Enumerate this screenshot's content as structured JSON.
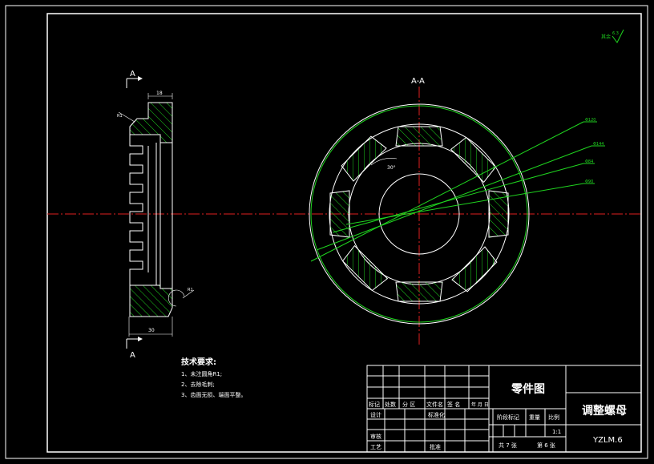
{
  "section_view": {
    "marker_top": "A",
    "marker_bottom": "A",
    "dim_top": "18",
    "dim_bottom": "30",
    "chamfer_top": "R1",
    "chamfer_bottom": "R1"
  },
  "front_view": {
    "title": "A-A",
    "angle_label": "30°",
    "leaders": [
      "Φ120",
      "Φ144",
      "Φ84",
      "Φ90"
    ]
  },
  "roughness": {
    "label": "其余",
    "value": "6.3"
  },
  "tech_req": {
    "title": "技术要求:",
    "items": [
      "1、未注圆角R1;",
      "2、去除毛刺;",
      "3、齿面无损、端面平整。"
    ]
  },
  "title_block": {
    "drawing_type": "零件图",
    "part_name": "调整螺母",
    "drawing_no": "YZLM.6",
    "scale": "1:1",
    "sheet_total": "共 7 张",
    "sheet_no": "第 6 张",
    "header_labels": [
      "标记",
      "处数",
      "分 区",
      "文件名",
      "签 名",
      "年 月 日"
    ],
    "row_labels": [
      "设计",
      "审核",
      "工艺"
    ],
    "standardization": "标准化",
    "approval": "批准",
    "stage_mark": "阶段标记",
    "weight": "重量",
    "ratio": "比例"
  }
}
